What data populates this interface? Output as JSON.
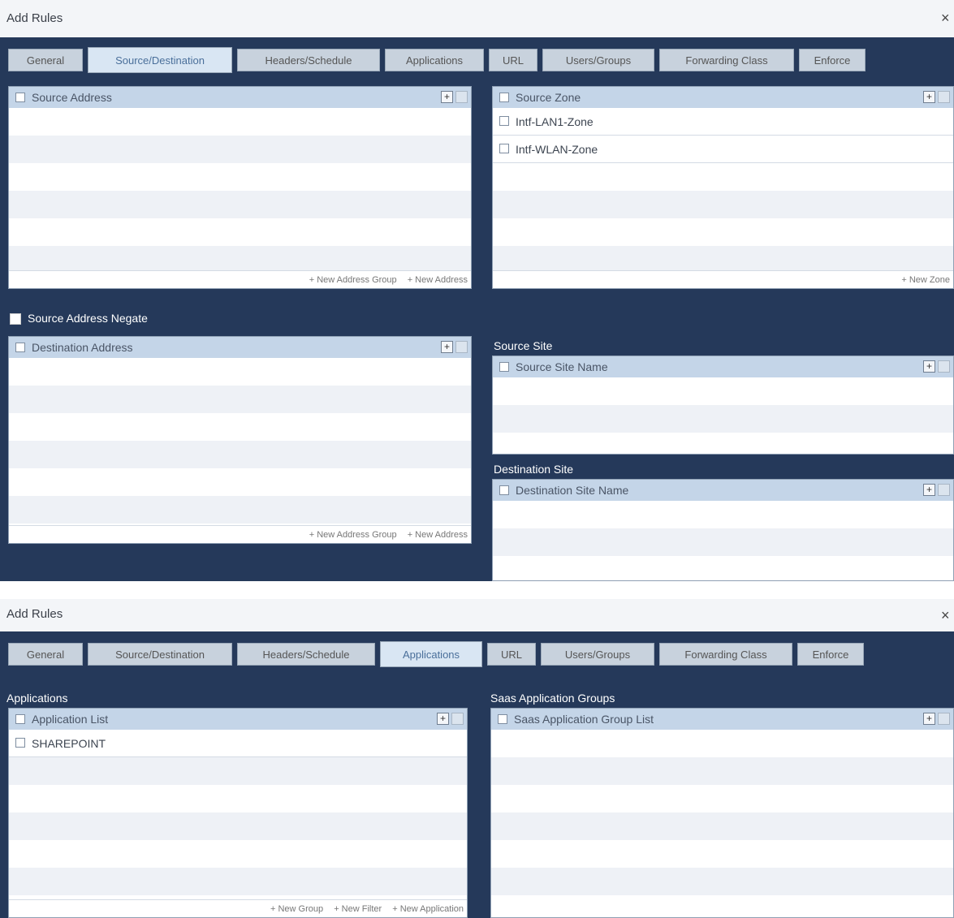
{
  "dialog1": {
    "title": "Add Rules",
    "close": "×",
    "tabs": [
      "General",
      "Source/Destination",
      "Headers/Schedule",
      "Applications",
      "URL",
      "Users/Groups",
      "Forwarding Class",
      "Enforce"
    ],
    "active_tab": "Source/Destination",
    "source_address": {
      "header": "Source Address",
      "footer_links": [
        "+ New Address Group",
        "+ New Address"
      ]
    },
    "source_zone": {
      "header": "Source Zone",
      "items": [
        "Intf-LAN1-Zone",
        "Intf-WLAN-Zone"
      ],
      "footer_links": [
        "+ New Zone"
      ]
    },
    "source_negate_label": "Source Address Negate",
    "destination_address": {
      "header": "Destination Address",
      "footer_links": [
        "+ New Address Group",
        "+ New Address"
      ]
    },
    "source_site": {
      "section": "Source Site",
      "header": "Source Site Name"
    },
    "destination_site": {
      "section": "Destination Site",
      "header": "Destination Site Name"
    }
  },
  "dialog2": {
    "title": "Add Rules",
    "close": "×",
    "tabs": [
      "General",
      "Source/Destination",
      "Headers/Schedule",
      "Applications",
      "URL",
      "Users/Groups",
      "Forwarding Class",
      "Enforce"
    ],
    "active_tab": "Applications",
    "applications": {
      "section": "Applications",
      "header": "Application List",
      "items": [
        "SHAREPOINT"
      ],
      "footer_links": [
        "+ New Group",
        "+ New Filter",
        "+ New Application"
      ]
    },
    "saas": {
      "section": "Saas Application Groups",
      "header": "Saas Application Group List"
    }
  },
  "icons": {
    "add": "plus-box-icon",
    "remove": "minus-box-icon"
  },
  "colors": {
    "body": "#25395a",
    "panel_header": "#c4d5e8",
    "tab": "#c8d2dd",
    "active_tab": "#d9e6f3"
  }
}
